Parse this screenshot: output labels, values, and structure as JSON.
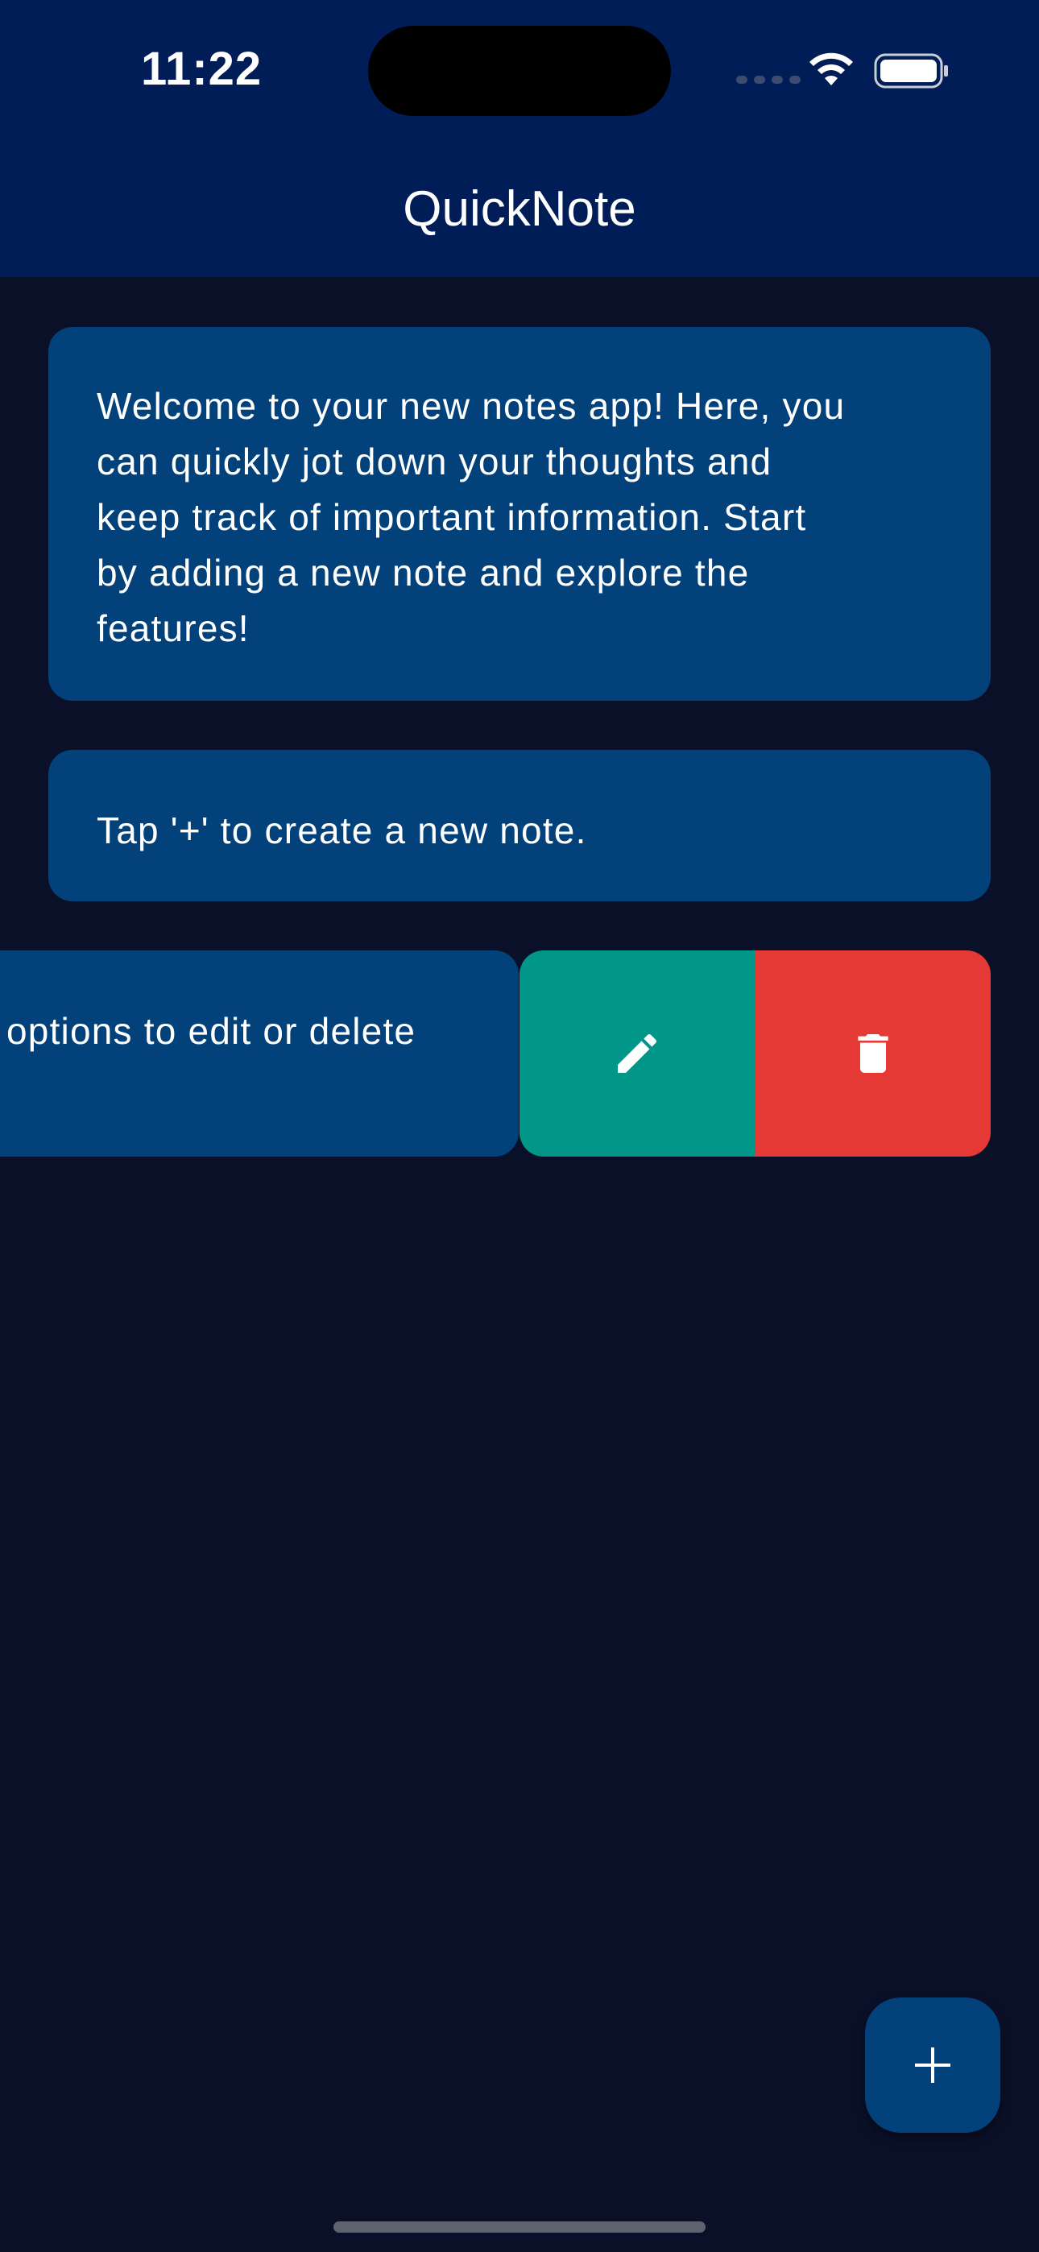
{
  "status_bar": {
    "time": "11:22"
  },
  "app_bar": {
    "title": "QuickNote"
  },
  "notes": [
    {
      "text": "Welcome to your new notes app! Here, you\ncan quickly jot down your thoughts and\nkeep track of important information. Start\nby adding a new note and explore the\nfeatures!"
    },
    {
      "text": "Tap '+' to create a new note."
    },
    {
      "text": "options to edit or delete"
    }
  ],
  "swipe_actions": {
    "edit_icon": "pencil-icon",
    "delete_icon": "trash-icon"
  },
  "fab": {
    "icon": "plus-icon"
  },
  "colors": {
    "app_bar": "#001d57",
    "background": "#0b1029",
    "card": "#03417a",
    "edit": "#009688",
    "delete": "#e53935"
  }
}
